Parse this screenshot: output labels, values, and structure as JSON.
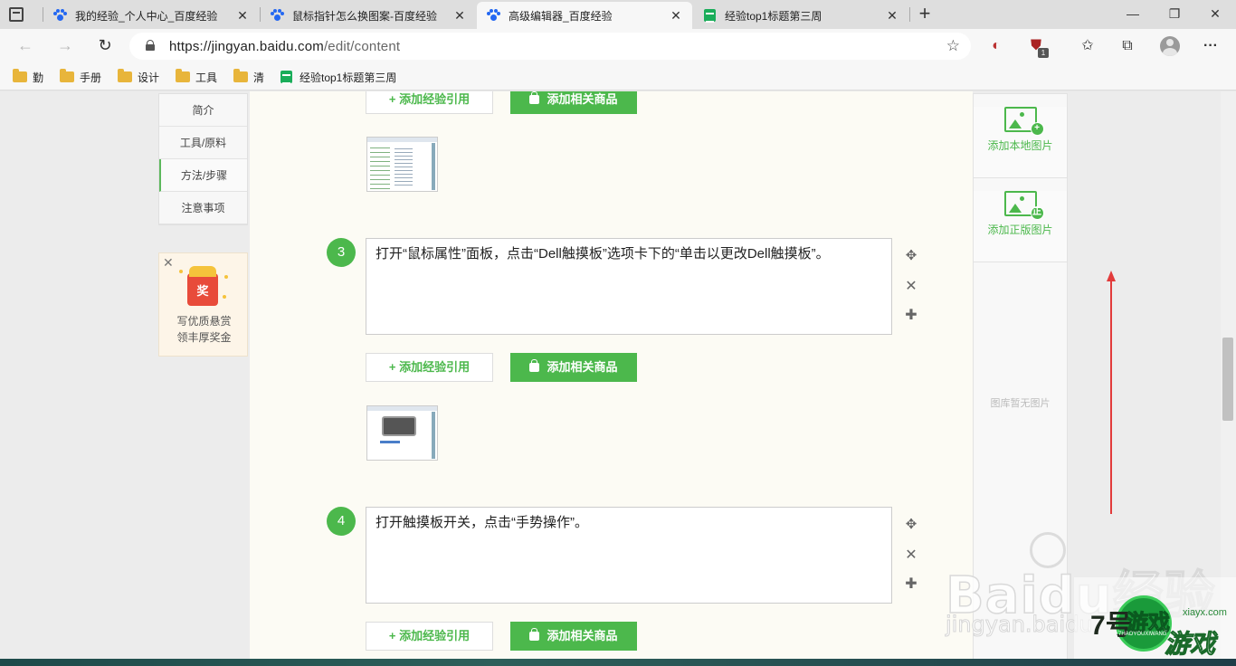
{
  "browser": {
    "tabs": [
      {
        "title": "我的经验_个人中心_百度经验",
        "icon": "baidu-paw-icon"
      },
      {
        "title": "鼠标指针怎么换图案-百度经验",
        "icon": "baidu-paw-icon"
      },
      {
        "title": "高级编辑器_百度经验",
        "icon": "baidu-paw-icon",
        "active": true
      },
      {
        "title": "经验top1标题第三周",
        "icon": "spreadsheet-icon"
      }
    ],
    "tab_close": "✕",
    "new_tab": "+",
    "window_controls": {
      "minimize": "—",
      "maximize": "❐",
      "close": "✕"
    },
    "url_host": "https://jingyan.baidu.com",
    "url_path": "/edit/content",
    "extension_badge": "1",
    "more": "···"
  },
  "bookmarks": [
    {
      "label": "勤",
      "type": "folder"
    },
    {
      "label": "手册",
      "type": "folder"
    },
    {
      "label": "设计",
      "type": "folder"
    },
    {
      "label": "工具",
      "type": "folder"
    },
    {
      "label": "清",
      "type": "folder"
    },
    {
      "label": "经验top1标题第三周",
      "type": "sheet"
    }
  ],
  "left_nav": {
    "items": [
      "简介",
      "工具/原料",
      "方法/步骤",
      "注意事项"
    ],
    "active_index": 2
  },
  "promo": {
    "close": "✕",
    "envelope_char": "奖",
    "line1": "写优质悬赏",
    "line2": "领丰厚奖金"
  },
  "buttons": {
    "add_quote": "+ 添加经验引用",
    "add_goods": "添加相关商品"
  },
  "steps": [
    {
      "number": "3",
      "text": "打开“鼠标属性”面板，点击“Dell触摸板”选项卡下的“单击以更改Dell触摸板”。"
    },
    {
      "number": "4",
      "text": "打开触摸板开关，点击“手势操作”。"
    }
  ],
  "step_controls": {
    "move": "✥",
    "delete": "✕",
    "add": "✚"
  },
  "right_panel": {
    "add_local": "添加本地图片",
    "add_licensed": "添加正版图片",
    "licensed_badge": "正",
    "empty": "图库暂无图片"
  },
  "watermarks": {
    "baidu": "Baidu经验",
    "baidu_url": "jingyan.baidu",
    "site_seven": "7号",
    "site_brand": "游戏",
    "site_small": "7HAOYOUXIWANG",
    "site_youxi": "游戏",
    "site_domain": "xiayx.com"
  },
  "colors": {
    "accent": "#4cb84c",
    "annotation_arrow": "#e23b3b"
  }
}
